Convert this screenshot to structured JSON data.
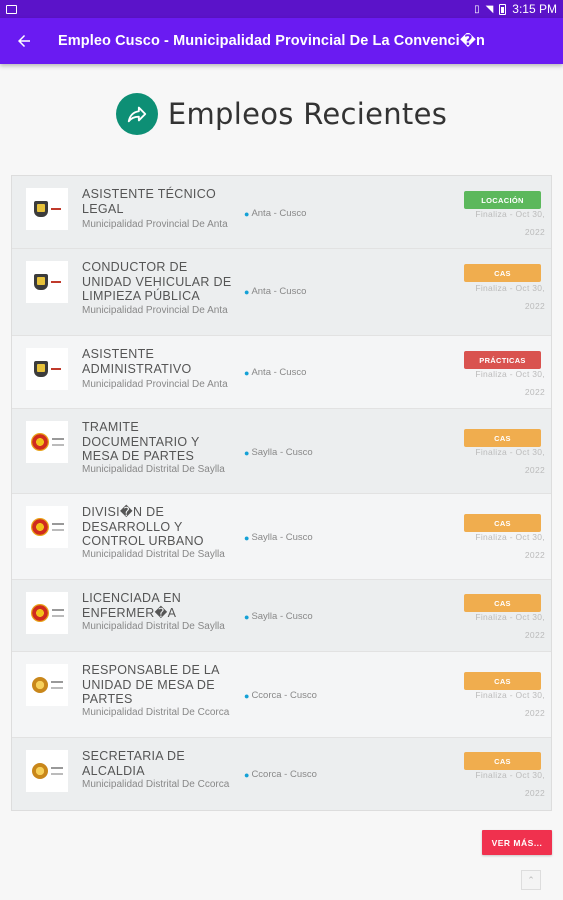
{
  "status_bar": {
    "time": "3:15 PM"
  },
  "app_bar": {
    "title": "Empleo Cusco - Municipalidad Provincial De La Convenci�n"
  },
  "heading": {
    "title": "Empleos Recientes"
  },
  "jobs": [
    {
      "title": "ASISTENTE TÉCNICO LEGAL",
      "org": "Municipalidad Provincial De Anta",
      "location": "Anta - Cusco",
      "badge": "LOCACIÓN",
      "badge_color": "#5cb85c",
      "date": "Finaliza - Oct 30, 2022",
      "logo": "crest"
    },
    {
      "title": "CONDUCTOR DE UNIDAD VEHICULAR DE LIMPIEZA PÚBLICA",
      "org": "Municipalidad Provincial De Anta",
      "location": "Anta - Cusco",
      "badge": "CAS",
      "badge_color": "#f0ad4e",
      "date": "Finaliza - Oct 30, 2022",
      "logo": "crest"
    },
    {
      "title": "ASISTENTE ADMINISTRATIVO",
      "org": "Municipalidad Provincial De Anta",
      "location": "Anta - Cusco",
      "badge": "PRÁCTICAS",
      "badge_color": "#d9534f",
      "date": "Finaliza - Oct 30, 2022",
      "logo": "crest"
    },
    {
      "title": "TRAMITE DOCUMENTARIO Y MESA DE PARTES",
      "org": "Municipalidad Distrital De Saylla",
      "location": "Saylla - Cusco",
      "badge": "CAS",
      "badge_color": "#f0ad4e",
      "date": "Finaliza - Oct 30, 2022",
      "logo": "seal"
    },
    {
      "title": "DIVISI�N DE DESARROLLO Y CONTROL URBANO",
      "org": "Municipalidad Distrital De Saylla",
      "location": "Saylla - Cusco",
      "badge": "CAS",
      "badge_color": "#f0ad4e",
      "date": "Finaliza - Oct 30, 2022",
      "logo": "seal"
    },
    {
      "title": "LICENCIADA EN ENFERMER�A",
      "org": "Municipalidad Distrital De Saylla",
      "location": "Saylla - Cusco",
      "badge": "CAS",
      "badge_color": "#f0ad4e",
      "date": "Finaliza - Oct 30, 2022",
      "logo": "seal"
    },
    {
      "title": "RESPONSABLE DE LA UNIDAD DE MESA DE PARTES",
      "org": "Municipalidad Distrital De Ccorca",
      "location": "Ccorca - Cusco",
      "badge": "CAS",
      "badge_color": "#f0ad4e",
      "date": "Finaliza - Oct 30, 2022",
      "logo": "seal2"
    },
    {
      "title": "SECRETARIA DE ALCALDIA",
      "org": "Municipalidad Distrital De Ccorca",
      "location": "Ccorca - Cusco",
      "badge": "CAS",
      "badge_color": "#f0ad4e",
      "date": "Finaliza - Oct 30, 2022",
      "logo": "seal2"
    }
  ],
  "ver_mas": {
    "label": "VER MÁS..."
  },
  "icons": {
    "back": "arrow-left-icon",
    "heading": "share-arrow-icon",
    "location": "map-pin-icon",
    "scroll_top": "chevron-up-icon"
  },
  "colors": {
    "app_bar": "#6a1bf2",
    "status_bar": "#5b13c9",
    "heading_icon": "#0d8f75",
    "ver_mas": "#f0314e"
  }
}
